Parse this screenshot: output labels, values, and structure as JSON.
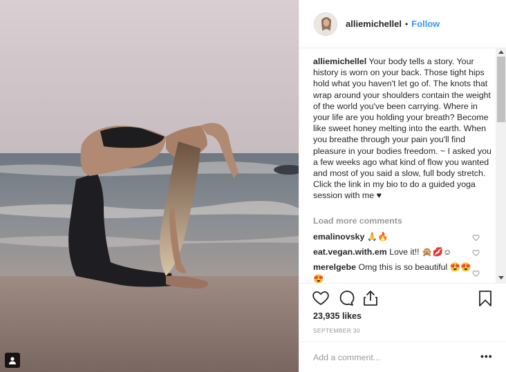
{
  "post": {
    "username": "alliemichellel",
    "separator": "•",
    "follow_label": "Follow",
    "caption_text": "Your body tells a story. Your history is worn on your back. Those tight hips hold what you haven't let go of. The knots that wrap around your shoulders contain the weight of the world you've been carrying. Where in your life are you holding your breath? Become like sweet honey melting into the earth. When you breathe through your pain you'll find pleasure in your bodies freedom. ~ I asked you a few weeks ago what kind of flow you wanted and most of you said a slow, full body stretch. Click the link in my bio to do a guided yoga session with me ♥",
    "load_more_label": "Load more comments",
    "comments": [
      {
        "user": "emalinovsky",
        "text": "🙏🔥"
      },
      {
        "user": "eat.vegan.with.em",
        "text": "Love it!! 🙊💋☺"
      },
      {
        "user": "merelgebe",
        "text": "Omg this is so beautiful 😍😍😍"
      }
    ],
    "likes": "23,935 likes",
    "date": "SEPTEMBER 30",
    "add_comment_placeholder": "Add a comment...",
    "more_label": "•••"
  },
  "icons": {
    "heart": "heart-icon",
    "comment": "comment-icon",
    "share": "share-icon",
    "bookmark": "bookmark-icon",
    "user_tag": "user-tag-icon",
    "scroll_up": "scroll-up-arrow",
    "scroll_down": "scroll-down-arrow"
  },
  "colors": {
    "link": "#3897f0",
    "text": "#262626",
    "muted": "#999999",
    "border": "#efefef"
  }
}
